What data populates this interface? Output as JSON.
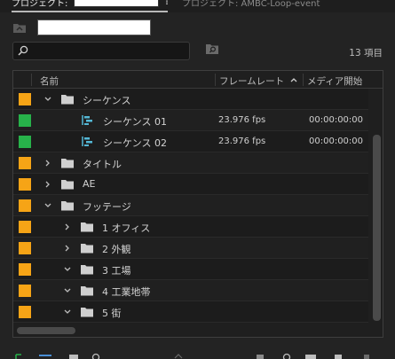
{
  "tabs": {
    "active_label": "プロジェクト:",
    "inactive_label": "プロジェクト: AMBC-Loop-event"
  },
  "search": {
    "placeholder": ""
  },
  "item_count": "13 項目",
  "columns": {
    "name": "名前",
    "frame_rate": "フレームレート",
    "media_start": "メディア開始"
  },
  "colors": {
    "orange": "#f6a416",
    "green": "#27b24a",
    "sequence_icon": "#54b8d6"
  },
  "rows": [
    {
      "label": "シーケンス",
      "type": "bin",
      "expanded": true,
      "indent": 0,
      "color": "orange"
    },
    {
      "label": "シーケンス 01",
      "type": "sequence",
      "indent": 2,
      "color": "green",
      "fps": "23.976 fps",
      "start": "00:00:00:00"
    },
    {
      "label": "シーケンス 02",
      "type": "sequence",
      "indent": 2,
      "color": "green",
      "fps": "23.976 fps",
      "start": "00:00:00:00"
    },
    {
      "label": "タイトル",
      "type": "bin",
      "expanded": false,
      "indent": 0,
      "color": "orange"
    },
    {
      "label": "AE",
      "type": "bin",
      "expanded": false,
      "indent": 0,
      "color": "orange"
    },
    {
      "label": "フッテージ",
      "type": "bin",
      "expanded": true,
      "indent": 0,
      "color": "orange"
    },
    {
      "label": "1 オフィス",
      "type": "bin",
      "expanded": false,
      "indent": 1,
      "color": "orange"
    },
    {
      "label": "2 外観",
      "type": "bin",
      "expanded": false,
      "indent": 1,
      "color": "orange"
    },
    {
      "label": "3 工場",
      "type": "bin",
      "expanded": true,
      "indent": 1,
      "color": "orange"
    },
    {
      "label": "4 工業地帯",
      "type": "bin",
      "expanded": true,
      "indent": 1,
      "color": "orange"
    },
    {
      "label": "5 街",
      "type": "bin",
      "expanded": true,
      "indent": 1,
      "color": "orange"
    }
  ]
}
